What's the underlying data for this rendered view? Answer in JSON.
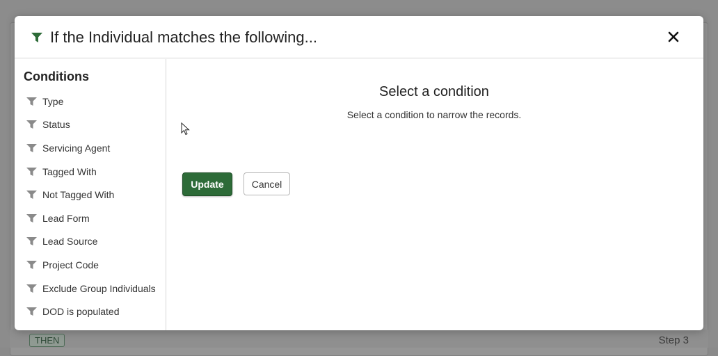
{
  "background": {
    "then_badge": "THEN",
    "step_label": "Step 3"
  },
  "modal": {
    "title": "If the Individual matches the following...",
    "header_icon": "filter-icon",
    "close_icon": "close-icon"
  },
  "sidebar": {
    "title": "Conditions",
    "items": [
      {
        "label": "Type"
      },
      {
        "label": "Status"
      },
      {
        "label": "Servicing Agent"
      },
      {
        "label": "Tagged With"
      },
      {
        "label": "Not Tagged With"
      },
      {
        "label": "Lead Form"
      },
      {
        "label": "Lead Source"
      },
      {
        "label": "Project Code"
      },
      {
        "label": "Exclude Group Individuals"
      },
      {
        "label": "DOD is populated"
      }
    ]
  },
  "main": {
    "heading": "Select a condition",
    "subtext": "Select a condition to narrow the records.",
    "update_label": "Update",
    "cancel_label": "Cancel"
  },
  "colors": {
    "accent_green": "#2d6b38",
    "icon_gray": "#8a8a8a"
  }
}
